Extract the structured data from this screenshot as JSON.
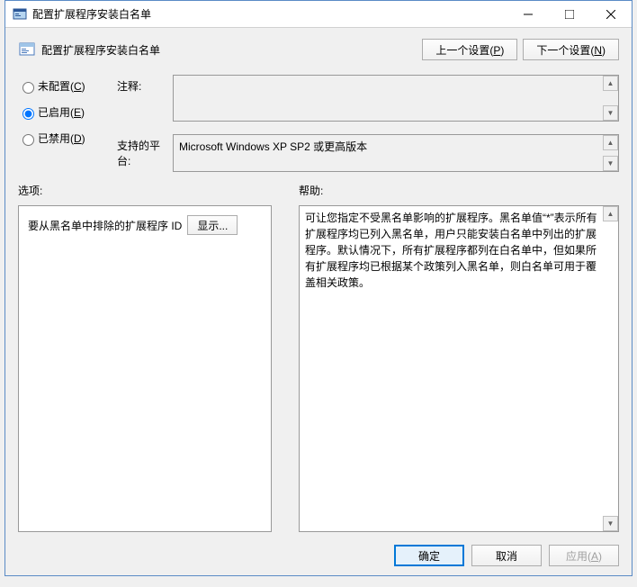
{
  "titlebar": {
    "title": "配置扩展程序安装白名单"
  },
  "header": {
    "title": "配置扩展程序安装白名单",
    "prev_button": "上一个设置(P)",
    "next_button": "下一个设置(N)"
  },
  "radios": {
    "not_configured": "未配置(C)",
    "enabled": "已启用(E)",
    "disabled": "已禁用(D)",
    "selected": "enabled"
  },
  "fields": {
    "comment_label": "注释:",
    "platform_label": "支持的平台:",
    "platform_value": "Microsoft Windows XP SP2 或更高版本"
  },
  "columns": {
    "options_label": "选项:",
    "help_label": "帮助:"
  },
  "options": {
    "extension_label": "要从黑名单中排除的扩展程序 ID",
    "show_button": "显示..."
  },
  "help": {
    "text": "可让您指定不受黑名单影响的扩展程序。黑名单值“*”表示所有扩展程序均已列入黑名单，用户只能安装白名单中列出的扩展程序。默认情况下，所有扩展程序都列在白名单中，但如果所有扩展程序均已根据某个政策列入黑名单，则白名单可用于覆盖相关政策。"
  },
  "footer": {
    "ok": "确定",
    "cancel": "取消",
    "apply": "应用(A)"
  }
}
